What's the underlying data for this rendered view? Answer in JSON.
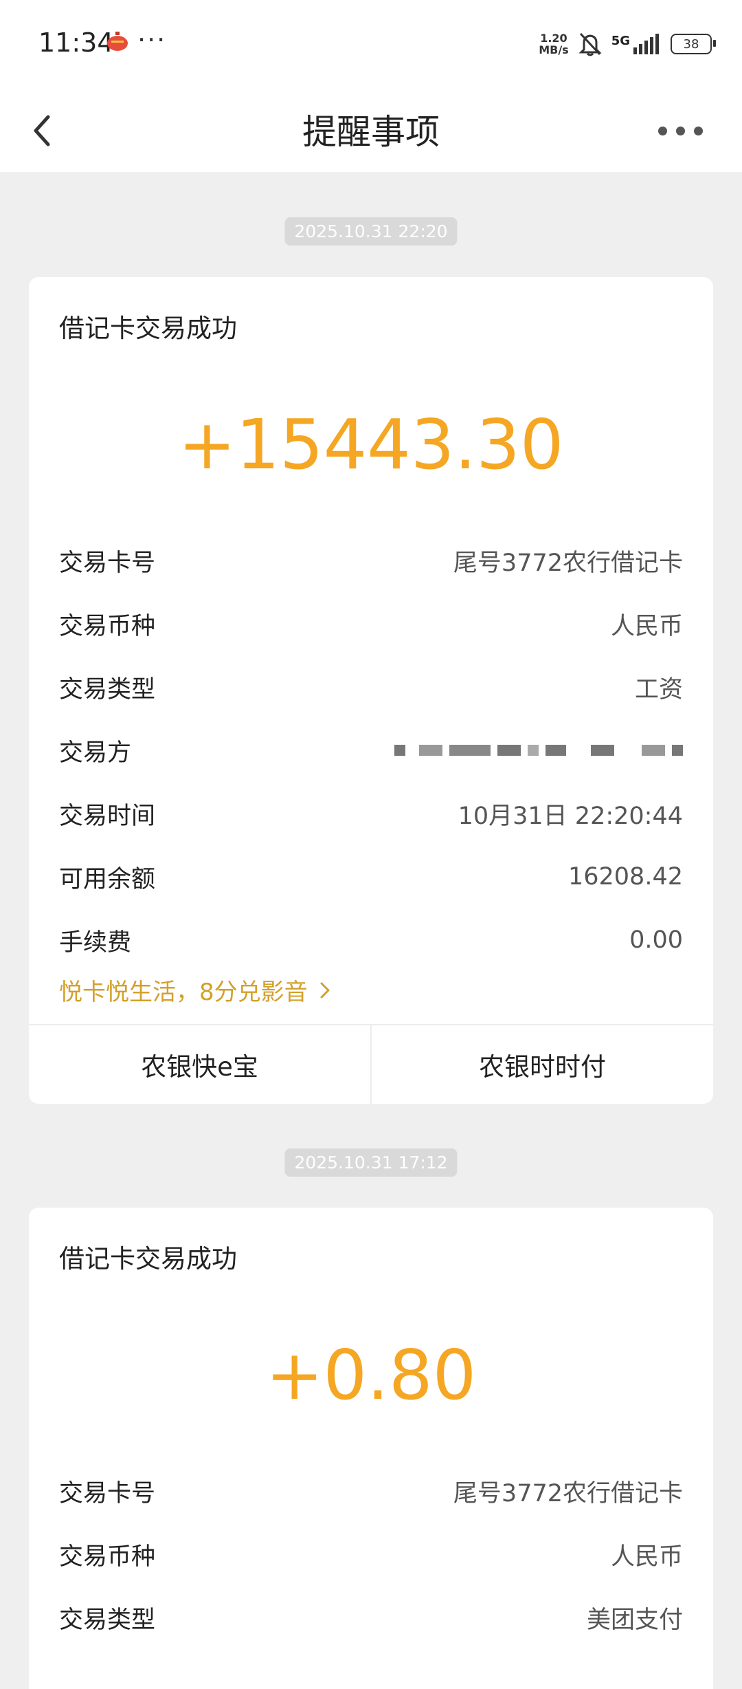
{
  "status_bar": {
    "time": "11:34",
    "dots": "···",
    "net_speed_value": "1.20",
    "net_speed_unit": "MB/s",
    "network": "5G",
    "battery": "38"
  },
  "nav": {
    "title": "提醒事项"
  },
  "notices": [
    {
      "timestamp": "2025.10.31 22:20",
      "title": "借记卡交易成功",
      "amount": "+15443.30",
      "rows": [
        {
          "label": "交易卡号",
          "value": "尾号3772农行借记卡"
        },
        {
          "label": "交易币种",
          "value": "人民币"
        },
        {
          "label": "交易类型",
          "value": "工资"
        },
        {
          "label": "交易方",
          "value": ""
        },
        {
          "label": "交易时间",
          "value": "10月31日 22:20:44"
        },
        {
          "label": "可用余额",
          "value": "16208.42"
        },
        {
          "label": "手续费",
          "value": "0.00"
        }
      ],
      "promo": "悦卡悦生活，8分兑影音",
      "actions": [
        "农银快e宝",
        "农银时时付"
      ]
    },
    {
      "timestamp": "2025.10.31 17:12",
      "title": "借记卡交易成功",
      "amount": "+0.80",
      "rows": [
        {
          "label": "交易卡号",
          "value": "尾号3772农行借记卡"
        },
        {
          "label": "交易币种",
          "value": "人民币"
        },
        {
          "label": "交易类型",
          "value": "美团支付"
        }
      ]
    }
  ],
  "colors": {
    "amount": "#f5a623",
    "promo": "#d4a02a",
    "background": "#efefef"
  },
  "icons": {
    "back": "chevron-left-icon",
    "more": "more-dots-icon",
    "promo_arrow": "chevron-right-icon",
    "mute": "bell-off-icon",
    "signal": "signal-icon",
    "lantern": "lantern-icon"
  }
}
